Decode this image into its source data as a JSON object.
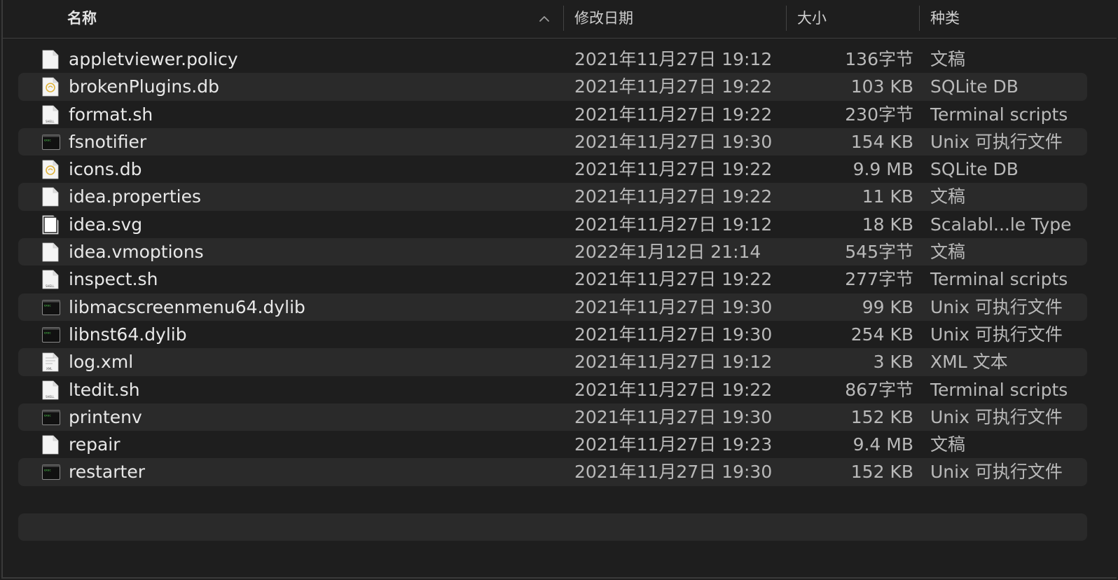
{
  "columns": {
    "name": "名称",
    "date": "修改日期",
    "size": "大小",
    "kind": "种类"
  },
  "files": [
    {
      "name": "appletviewer.policy",
      "date": "2021年11月27日 19:12",
      "size": "136字节",
      "kind": "文稿",
      "icon": "document-icon"
    },
    {
      "name": "brokenPlugins.db",
      "date": "2021年11月27日 19:22",
      "size": "103 KB",
      "kind": "SQLite DB",
      "icon": "database-icon"
    },
    {
      "name": "format.sh",
      "date": "2021年11月27日 19:22",
      "size": "230字节",
      "kind": "Terminal scripts",
      "icon": "shell-script-icon"
    },
    {
      "name": "fsnotifier",
      "date": "2021年11月27日 19:30",
      "size": "154 KB",
      "kind": "Unix 可执行文件",
      "icon": "executable-icon"
    },
    {
      "name": "icons.db",
      "date": "2021年11月27日 19:22",
      "size": "9.9 MB",
      "kind": "SQLite DB",
      "icon": "database-icon"
    },
    {
      "name": "idea.properties",
      "date": "2021年11月27日 19:22",
      "size": "11 KB",
      "kind": "文稿",
      "icon": "document-icon"
    },
    {
      "name": "idea.svg",
      "date": "2021年11月27日 19:12",
      "size": "18 KB",
      "kind": "Scalabl...le Type",
      "icon": "svg-file-icon"
    },
    {
      "name": "idea.vmoptions",
      "date": "2022年1月12日 21:14",
      "size": "545字节",
      "kind": "文稿",
      "icon": "document-icon"
    },
    {
      "name": "inspect.sh",
      "date": "2021年11月27日 19:22",
      "size": "277字节",
      "kind": "Terminal scripts",
      "icon": "shell-script-icon"
    },
    {
      "name": "libmacscreenmenu64.dylib",
      "date": "2021年11月27日 19:30",
      "size": "99 KB",
      "kind": "Unix 可执行文件",
      "icon": "executable-icon"
    },
    {
      "name": "libnst64.dylib",
      "date": "2021年11月27日 19:30",
      "size": "254 KB",
      "kind": "Unix 可执行文件",
      "icon": "executable-icon"
    },
    {
      "name": "log.xml",
      "date": "2021年11月27日 19:12",
      "size": "3 KB",
      "kind": "XML 文本",
      "icon": "xml-file-icon"
    },
    {
      "name": "ltedit.sh",
      "date": "2021年11月27日 19:22",
      "size": "867字节",
      "kind": "Terminal scripts",
      "icon": "shell-script-icon"
    },
    {
      "name": "printenv",
      "date": "2021年11月27日 19:30",
      "size": "152 KB",
      "kind": "Unix 可执行文件",
      "icon": "executable-icon"
    },
    {
      "name": "repair",
      "date": "2021年11月27日 19:23",
      "size": "9.4 MB",
      "kind": "文稿",
      "icon": "document-icon"
    },
    {
      "name": "restarter",
      "date": "2021年11月27日 19:30",
      "size": "152 KB",
      "kind": "Unix 可执行文件",
      "icon": "executable-icon"
    }
  ],
  "colors": {
    "background": "#1e1e1e",
    "row_alt": "#2a2a2a",
    "text_primary": "#e8e8e8",
    "text_secondary": "#b9b9b9"
  }
}
